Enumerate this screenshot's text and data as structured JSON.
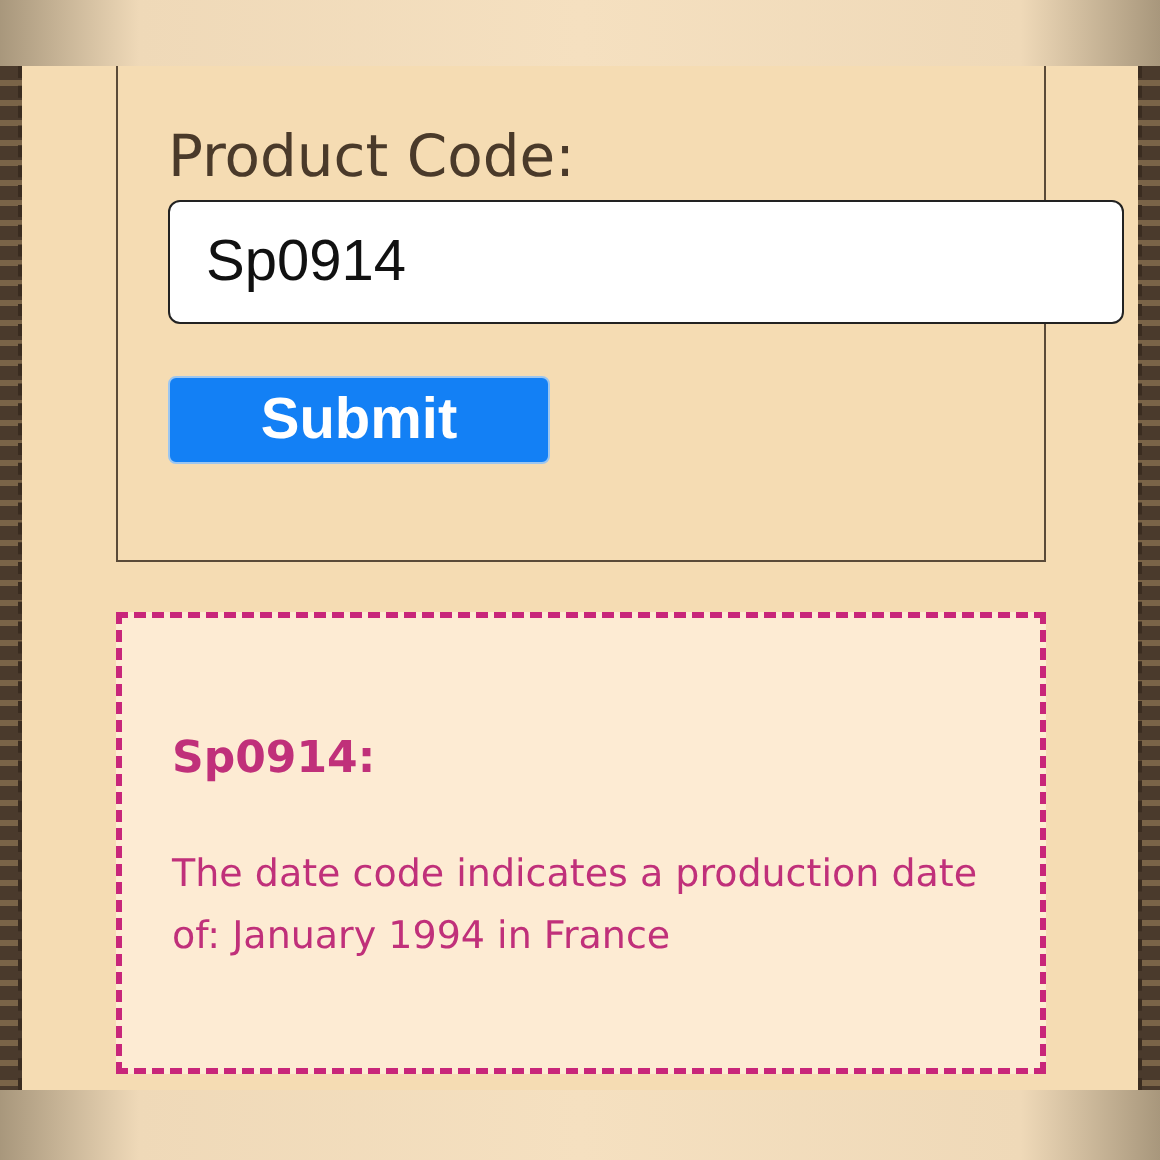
{
  "form": {
    "label": "Product Code:",
    "input_value": "Sp0914",
    "button": "Submit"
  },
  "result": {
    "code": "Sp0914:",
    "message": "The date code indicates a production date of: January 1994 in France"
  }
}
